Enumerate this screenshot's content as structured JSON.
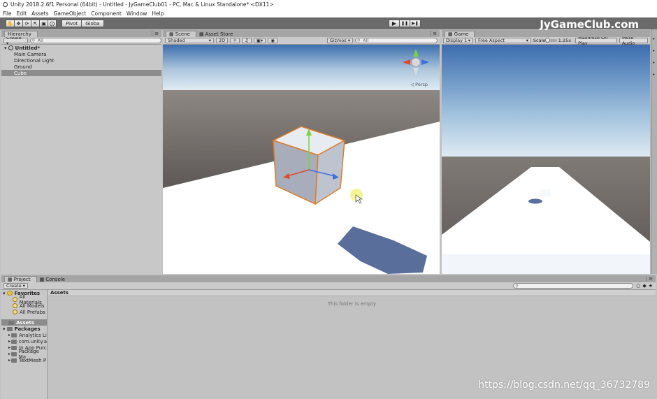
{
  "window": {
    "title": "Unity 2018.2.6f1 Personal (64bit) - Untitled - JyGameClub01 - PC, Mac & Linux Standalone* <DX11>"
  },
  "menu": [
    "File",
    "Edit",
    "Assets",
    "GameObject",
    "Component",
    "Window",
    "Help"
  ],
  "toolbar": {
    "pivot_label": "Pivot",
    "global_label": "Globa",
    "play_icon": "▶",
    "pause_icon": "❚❚",
    "step_icon": "▶❚"
  },
  "watermark_top": "JyGameClub.com",
  "watermark_bottom": "https://blog.csdn.net/qq_36732789",
  "hierarchy": {
    "tab_label": "Hierarchy",
    "create_label": "Create ▾",
    "search_placeholder": "All",
    "scene_name": "Untitled*",
    "items": [
      "Main Camera",
      "Directional Light",
      "Ground",
      "Cube"
    ],
    "selected_index": 3
  },
  "scene": {
    "tab_label": "Scene",
    "asset_store_tab": "Asset Store",
    "shading_mode": "Shaded",
    "mode_2d": "2D",
    "gizmos_label": "Gizmos ▾",
    "search_placeholder": "All",
    "persp_label": "◁ Persp"
  },
  "game": {
    "tab_label": "Game",
    "display": "Display 1",
    "aspect": "Free Aspect",
    "scale_label": "Scale",
    "scale_value": "1.25x",
    "maximize_label": "Maximize On Play",
    "mute_label": "Mute Audio"
  },
  "project": {
    "tab_label": "Project",
    "console_tab": "Console",
    "create_label": "Create ▾",
    "favorites_label": "Favorites",
    "favorites": [
      "All Materials",
      "All Models",
      "All Prefabs"
    ],
    "assets_label": "Assets",
    "packages_label": "Packages",
    "packages": [
      "Analytics Li",
      "com.unity.a",
      "In App Purc",
      "Package Ma",
      "TextMesh P"
    ],
    "breadcrumb": "Assets",
    "empty_message": "This folder is empty"
  },
  "colors": {
    "toolbar_bg": "#6a6a6a",
    "panel_bg": "#c8c8c8",
    "selection": "#8c8c8c",
    "ground": "#ffffff",
    "horizon": "#5e5a58",
    "sky_top": "#3c6fb0"
  }
}
